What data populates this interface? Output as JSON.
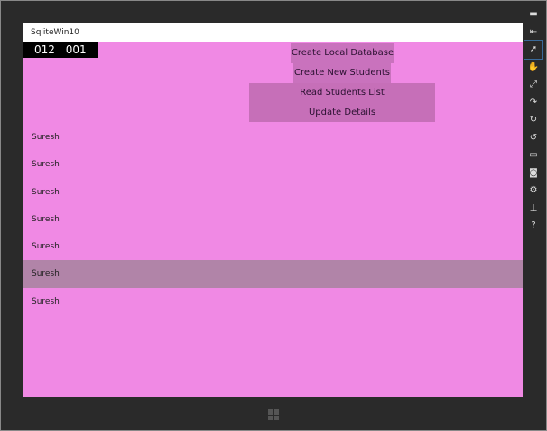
{
  "app": {
    "title": "SqliteWin10",
    "counter": "012 001"
  },
  "buttons": [
    "Create Local Database",
    "Create New Students",
    "Read Students List",
    "Update Details"
  ],
  "students": [
    "Suresh",
    "Suresh",
    "Suresh",
    "Suresh",
    "Suresh",
    "Suresh",
    "Suresh"
  ],
  "selected_index": 5,
  "toolbar": [
    {
      "icon": "minimize-icon",
      "g": "▬"
    },
    {
      "icon": "pin-icon",
      "g": "⇤"
    },
    {
      "icon": "pointer-icon",
      "g": "➚"
    },
    {
      "icon": "hand-icon",
      "g": "✋"
    },
    {
      "icon": "pinch-icon",
      "g": "⤢"
    },
    {
      "icon": "rotate-gesture-icon",
      "g": "↷"
    },
    {
      "icon": "rotate-clockwise-icon",
      "g": "↻"
    },
    {
      "icon": "rotate-counterclockwise-icon",
      "g": "↺"
    },
    {
      "icon": "resolution-icon",
      "g": "▭"
    },
    {
      "icon": "camera-icon",
      "g": "◙"
    },
    {
      "icon": "settings-icon",
      "g": "⚙"
    },
    {
      "icon": "network-icon",
      "g": "⊥"
    },
    {
      "icon": "help-icon",
      "g": "?"
    }
  ]
}
